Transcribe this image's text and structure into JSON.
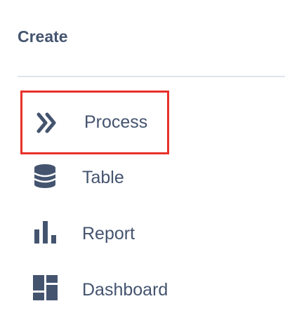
{
  "create_menu": {
    "heading": "Create",
    "items": [
      {
        "label": "Process",
        "icon": "chevrons-right-icon",
        "highlighted": true
      },
      {
        "label": "Table",
        "icon": "database-icon",
        "highlighted": false
      },
      {
        "label": "Report",
        "icon": "bar-chart-icon",
        "highlighted": false
      },
      {
        "label": "Dashboard",
        "icon": "dashboard-icon",
        "highlighted": false
      }
    ]
  },
  "colors": {
    "text": "#44546f",
    "icon": "#44546f",
    "divider": "#dfe3ec",
    "highlight_border": "#e8312b",
    "background": "#ffffff"
  }
}
